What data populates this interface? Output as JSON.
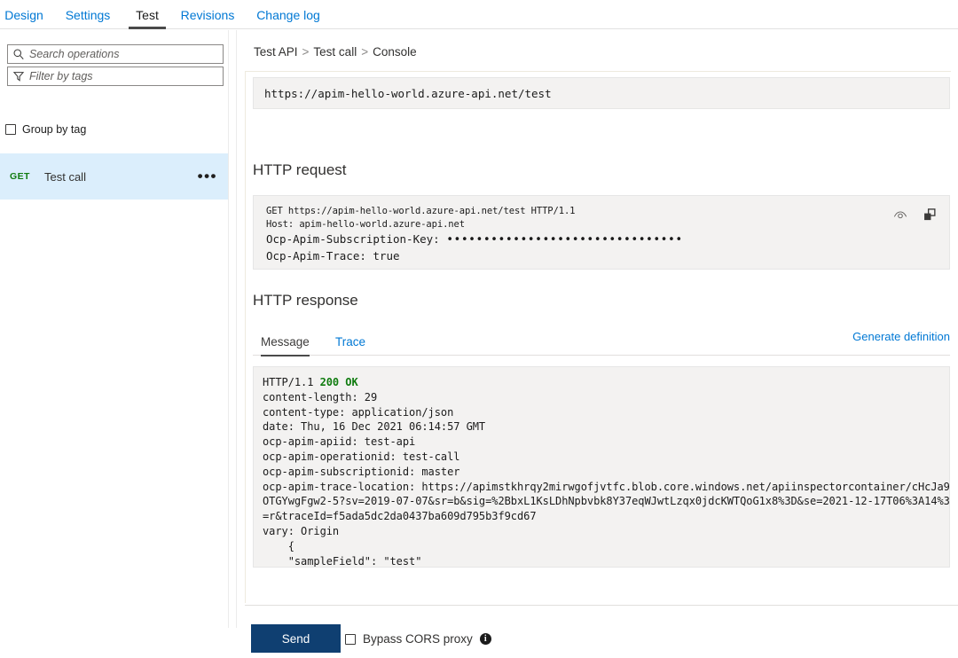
{
  "tabs": [
    {
      "label": "Design",
      "active": false
    },
    {
      "label": "Settings",
      "active": false
    },
    {
      "label": "Test",
      "active": true
    },
    {
      "label": "Revisions",
      "active": false
    },
    {
      "label": "Change log",
      "active": false
    }
  ],
  "sidebar": {
    "search": {
      "placeholder": "Search operations",
      "value": "",
      "icon": "search-icon"
    },
    "filter": {
      "placeholder": "Filter by tags",
      "value": "",
      "icon": "filter-icon"
    },
    "group_by_tag": {
      "label": "Group by tag",
      "checked": false
    },
    "operations": [
      {
        "verb": "GET",
        "name": "Test call",
        "selected": true,
        "overflow": "•••"
      }
    ]
  },
  "breadcrumb": {
    "items": [
      "Test API",
      "Test call",
      "Console"
    ],
    "separator": ">"
  },
  "console": {
    "url": "https://apim-hello-world.azure-api.net/test",
    "request": {
      "title": "HTTP request",
      "line1": "GET https://apim-hello-world.azure-api.net/test HTTP/1.1",
      "line2": "Host: apim-hello-world.azure-api.net",
      "subscription_key_label": "Ocp-Apim-Subscription-Key:",
      "subscription_key_masked": "••••••••••••••••••••••••••••••••",
      "trace_line": "Ocp-Apim-Trace: true",
      "eye_icon": "eye-icon",
      "copy_icon": "copy-icon"
    },
    "response": {
      "title": "HTTP response",
      "tabs": [
        {
          "label": "Message",
          "active": true
        },
        {
          "label": "Trace",
          "active": false
        }
      ],
      "generate_definition": "Generate definition",
      "status_prefix": "HTTP/1.1 ",
      "status_code": "200 OK",
      "headers_and_body": "content-length: 29\ncontent-type: application/json\ndate: Thu, 16 Dec 2021 06:14:57 GMT\nocp-apim-apiid: test-api\nocp-apim-operationid: test-call\nocp-apim-subscriptionid: master\nocp-apim-trace-location: https://apimstkhrqy2mirwgofjvtfc.blob.core.windows.net/apiinspectorcontainer/cHcJa9krxa3Ph\nOTGYwgFgw2-5?sv=2019-07-07&sr=b&sig=%2BbxL1KsLDhNpbvbk8Y37eqWJwtLzqx0jdcKWTQoG1x8%3D&se=2021-12-17T06%3A14%3A55Z&sp\n=r&traceId=f5ada5dc2da0437ba609d795b3f9cd67\nvary: Origin\n    {\n    \"sampleField\": \"test\"\n}"
    },
    "actions": {
      "send_label": "Send",
      "bypass_cors_label": "Bypass CORS proxy",
      "bypass_cors_checked": false,
      "info_icon": "info-icon",
      "info_glyph": "i"
    }
  },
  "colors": {
    "link": "#0078d4",
    "verb_get": "#107c10",
    "status_ok": "#107c10",
    "selected_row": "#dbeefc",
    "send_button": "#0f3f71"
  }
}
